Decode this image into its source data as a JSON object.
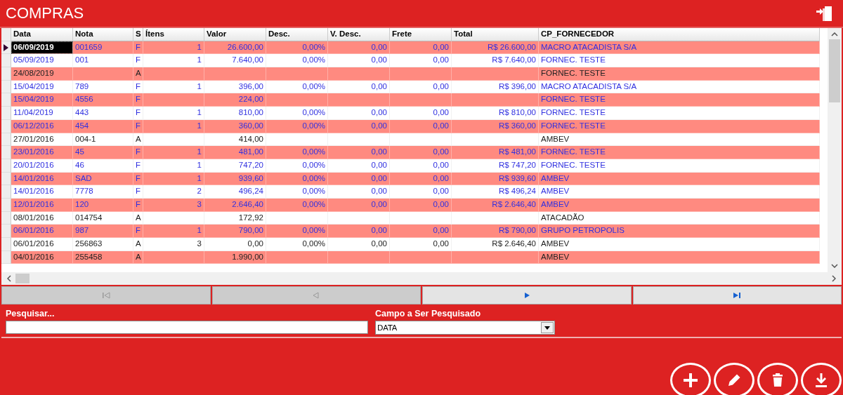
{
  "window": {
    "title": "COMPRAS"
  },
  "table": {
    "columns": [
      "Data",
      "Nota",
      "S",
      "Ítens",
      "Valor",
      "Desc.",
      "V. Desc.",
      "Frete",
      "Total",
      "CP_FORNECEDOR"
    ],
    "rows": [
      {
        "selected": true,
        "kind": "final",
        "cells": [
          "06/09/2019",
          "001659",
          "F",
          "1",
          "26.600,00",
          "0,00%",
          "0,00",
          "0,00",
          "R$ 26.600,00",
          "MACRO ATACADISTA S/A"
        ]
      },
      {
        "selected": false,
        "kind": "final",
        "cells": [
          "05/09/2019",
          "001",
          "F",
          "1",
          "7.640,00",
          "0,00%",
          "0,00",
          "0,00",
          "R$ 7.640,00",
          "FORNEC. TESTE"
        ]
      },
      {
        "selected": false,
        "kind": "open",
        "cells": [
          "24/08/2019",
          null,
          "A",
          null,
          null,
          null,
          null,
          null,
          null,
          "FORNEC. TESTE"
        ]
      },
      {
        "selected": false,
        "kind": "final",
        "cells": [
          "15/04/2019",
          "789",
          "F",
          "1",
          "396,00",
          "0,00%",
          "0,00",
          "0,00",
          "R$ 396,00",
          "MACRO ATACADISTA S/A"
        ]
      },
      {
        "selected": false,
        "kind": "final",
        "cells": [
          "15/04/2019",
          "4556",
          "F",
          null,
          "224,00",
          null,
          null,
          null,
          null,
          "FORNEC. TESTE"
        ]
      },
      {
        "selected": false,
        "kind": "final",
        "cells": [
          "11/04/2019",
          "443",
          "F",
          "1",
          "810,00",
          "0,00%",
          "0,00",
          "0,00",
          "R$ 810,00",
          "FORNEC. TESTE"
        ]
      },
      {
        "selected": false,
        "kind": "final",
        "cells": [
          "06/12/2016",
          "454",
          "F",
          "1",
          "360,00",
          "0,00%",
          "0,00",
          "0,00",
          "R$ 360,00",
          "FORNEC. TESTE"
        ]
      },
      {
        "selected": false,
        "kind": "open",
        "cells": [
          "27/01/2016",
          "004-1",
          "A",
          null,
          "414,00",
          null,
          null,
          null,
          null,
          "AMBEV"
        ]
      },
      {
        "selected": false,
        "kind": "final",
        "cells": [
          "23/01/2016",
          "45",
          "F",
          "1",
          "481,00",
          "0,00%",
          "0,00",
          "0,00",
          "R$ 481,00",
          "FORNEC. TESTE"
        ]
      },
      {
        "selected": false,
        "kind": "final",
        "cells": [
          "20/01/2016",
          "46",
          "F",
          "1",
          "747,20",
          "0,00%",
          "0,00",
          "0,00",
          "R$ 747,20",
          "FORNEC. TESTE"
        ]
      },
      {
        "selected": false,
        "kind": "final",
        "cells": [
          "14/01/2016",
          "SAD",
          "F",
          "1",
          "939,60",
          "0,00%",
          "0,00",
          "0,00",
          "R$ 939,60",
          "AMBEV"
        ]
      },
      {
        "selected": false,
        "kind": "final",
        "cells": [
          "14/01/2016",
          "7778",
          "F",
          "2",
          "496,24",
          "0,00%",
          "0,00",
          "0,00",
          "R$ 496,24",
          "AMBEV"
        ]
      },
      {
        "selected": false,
        "kind": "final",
        "cells": [
          "12/01/2016",
          "120",
          "F",
          "3",
          "2.646,40",
          "0,00%",
          "0,00",
          "0,00",
          "R$ 2.646,40",
          "AMBEV"
        ]
      },
      {
        "selected": false,
        "kind": "open",
        "cells": [
          "08/01/2016",
          "014754",
          "A",
          null,
          "172,92",
          null,
          null,
          null,
          null,
          "ATACADÃO"
        ]
      },
      {
        "selected": false,
        "kind": "final",
        "cells": [
          "06/01/2016",
          "987",
          "F",
          "1",
          "790,00",
          "0,00%",
          "0,00",
          "0,00",
          "R$ 790,00",
          "GRUPO PETROPOLIS"
        ]
      },
      {
        "selected": false,
        "kind": "open",
        "cells": [
          "06/01/2016",
          "256863",
          "A",
          "3",
          "0,00",
          "0,00%",
          "0,00",
          "0,00",
          "R$ 2.646,40",
          "AMBEV"
        ]
      },
      {
        "selected": false,
        "kind": "open",
        "cells": [
          "04/01/2016",
          "255458",
          "A",
          null,
          "1.990,00",
          null,
          null,
          null,
          null,
          "AMBEV"
        ]
      }
    ]
  },
  "navigator": [
    {
      "kind": "first",
      "disabled": true
    },
    {
      "kind": "prev",
      "disabled": true
    },
    {
      "kind": "next",
      "disabled": false
    },
    {
      "kind": "last",
      "disabled": false
    }
  ],
  "search": {
    "label": "Pesquisar...",
    "field_label": "Campo a Ser Pesquisado",
    "field_value": "DATA"
  },
  "actions": [
    {
      "kind": "add"
    },
    {
      "kind": "edit"
    },
    {
      "kind": "delete"
    },
    {
      "kind": "download"
    }
  ]
}
